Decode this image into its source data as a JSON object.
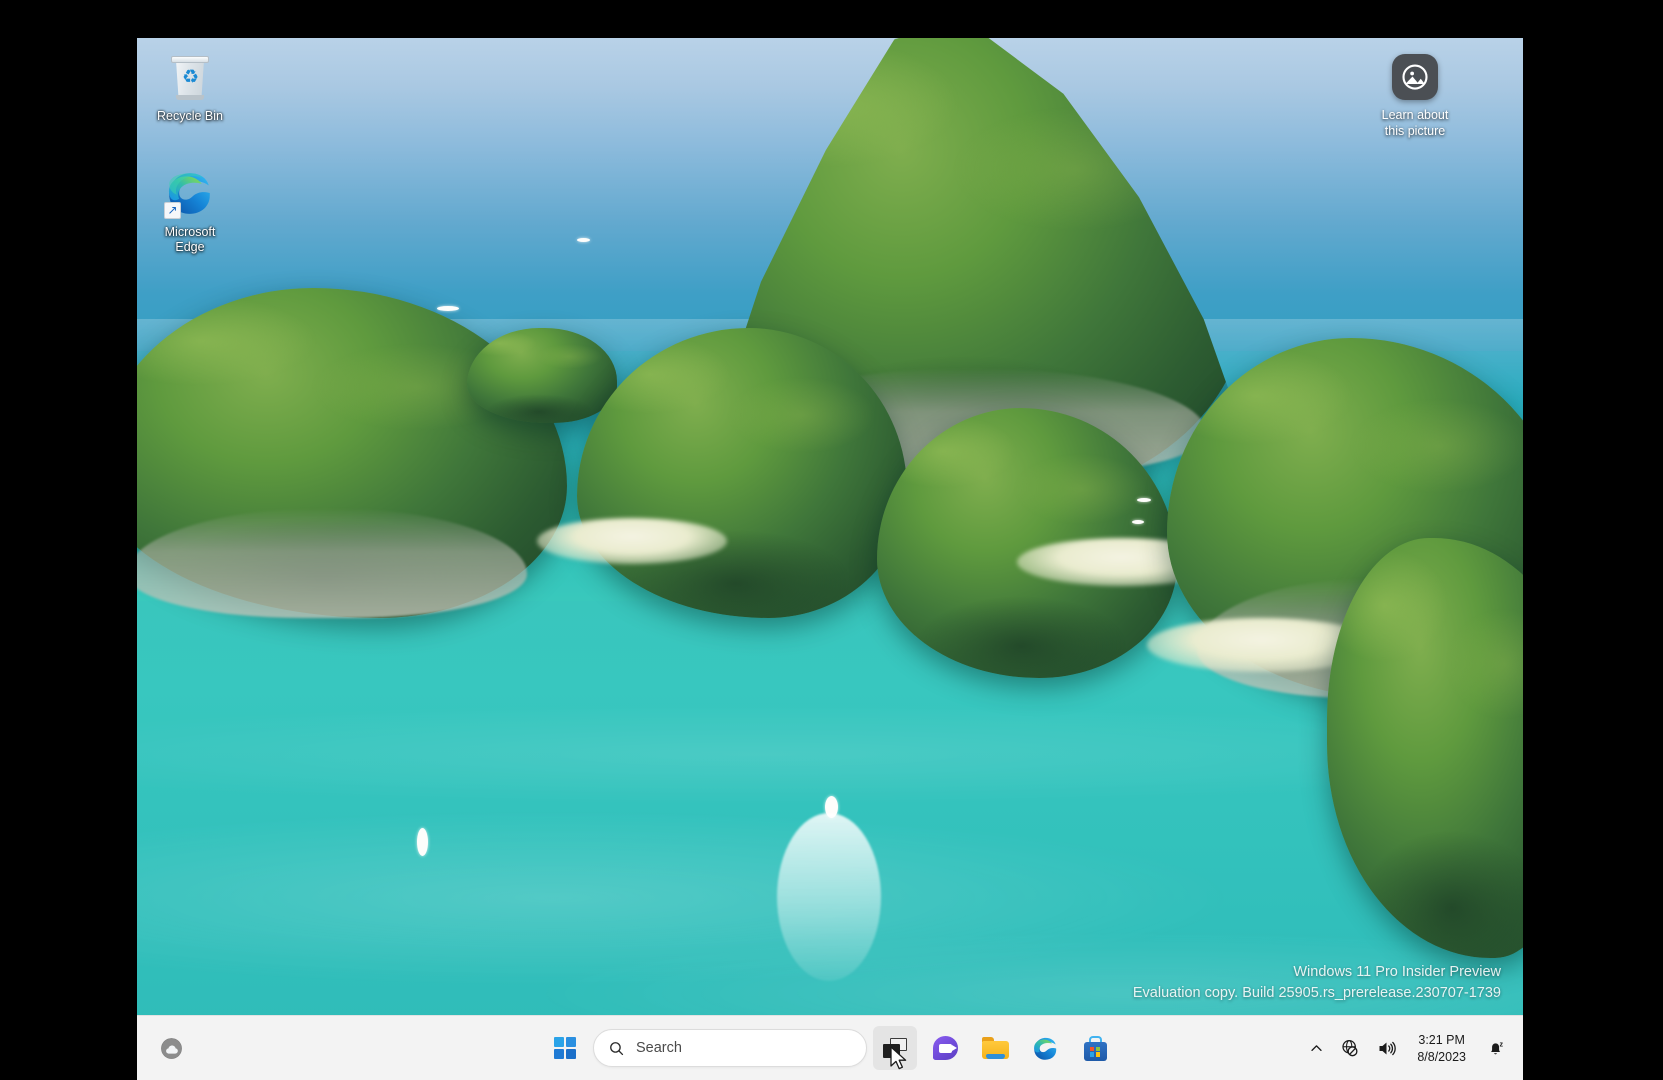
{
  "desktop": {
    "icons": [
      {
        "name": "recycle-bin",
        "label": "Recycle Bin",
        "icon": "recycle-bin-icon"
      },
      {
        "name": "microsoft-edge",
        "label_line1": "Microsoft",
        "label_line2": "Edge",
        "icon": "edge-icon",
        "overlay": "shortcut-arrow-icon"
      }
    ],
    "learn_widget": {
      "icon": "picture-icon",
      "label_line1": "Learn about",
      "label_line2": "this picture"
    },
    "watermark": {
      "line1": "Windows 11 Pro Insider Preview",
      "line2": "Evaluation copy. Build 25905.rs_prerelease.230707-1739"
    },
    "wallpaper_colors": {
      "sky": "#8dbbdc",
      "sea": "#2ba0bf",
      "lagoon": "#34c3bd",
      "foliage": "#5f9a3e"
    }
  },
  "taskbar": {
    "background": "#f3f3f3",
    "widgets_button": {
      "name": "widgets-weather-button",
      "icon": "weather-cloud-icon"
    },
    "start_button": {
      "name": "start-button",
      "label": "Start",
      "icon": "windows-logo-icon"
    },
    "search": {
      "name": "taskbar-search",
      "placeholder": "Search",
      "value": "",
      "icon": "search-icon"
    },
    "apps": [
      {
        "name": "task-view-button",
        "label": "Task View",
        "icon": "task-view-icon",
        "active": true
      },
      {
        "name": "chat-button",
        "label": "Chat",
        "icon": "chat-video-icon",
        "active": false
      },
      {
        "name": "file-explorer-button",
        "label": "File Explorer",
        "icon": "folder-icon",
        "active": false
      },
      {
        "name": "edge-button",
        "label": "Microsoft Edge",
        "icon": "edge-icon",
        "active": false
      },
      {
        "name": "store-button",
        "label": "Microsoft Store",
        "icon": "store-bag-icon",
        "active": false
      }
    ],
    "tray": {
      "overflow": {
        "name": "show-hidden-icons",
        "icon": "chevron-up-icon",
        "glyph": "⌃"
      },
      "network": {
        "name": "network-icon",
        "icon": "globe-no-internet-icon",
        "status": "no-internet"
      },
      "volume": {
        "name": "volume-icon",
        "icon": "speaker-icon"
      },
      "clock": {
        "name": "clock",
        "time": "3:21 PM",
        "date": "8/8/2023"
      },
      "notifications": {
        "name": "notifications-button",
        "icon": "bell-do-not-disturb-icon",
        "state": "do-not-disturb"
      }
    }
  }
}
